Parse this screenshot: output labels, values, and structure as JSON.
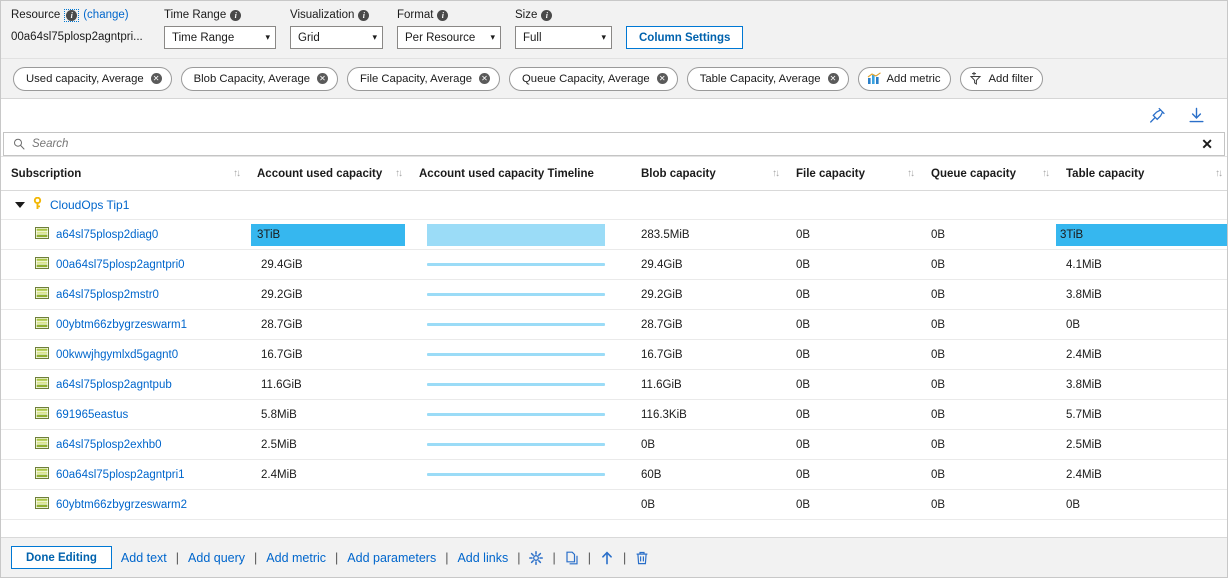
{
  "toolbar": {
    "resource": {
      "label": "Resource",
      "info_icon": "info-icon",
      "change_label": "(change)",
      "value": "00a64sl75plosp2agntpri..."
    },
    "params": [
      {
        "label": "Time Range",
        "info_icon": "info-icon",
        "value": "Time Range",
        "caret_icon": "chevron-down-icon"
      },
      {
        "label": "Visualization",
        "info_icon": "info-icon",
        "value": "Grid",
        "caret_icon": "chevron-down-icon"
      },
      {
        "label": "Format",
        "info_icon": "info-icon",
        "value": "Per Resource",
        "caret_icon": "chevron-down-icon"
      },
      {
        "label": "Size",
        "info_icon": "info-icon",
        "value": "Full",
        "caret_icon": "chevron-down-icon"
      }
    ],
    "column_settings_label": "Column Settings"
  },
  "pills": {
    "metrics": [
      {
        "label": "Used capacity, Average",
        "remove_icon": "close-circle-icon"
      },
      {
        "label": "Blob Capacity, Average",
        "remove_icon": "close-circle-icon"
      },
      {
        "label": "File Capacity, Average",
        "remove_icon": "close-circle-icon"
      },
      {
        "label": "Queue Capacity, Average",
        "remove_icon": "close-circle-icon"
      },
      {
        "label": "Table Capacity, Average",
        "remove_icon": "close-circle-icon"
      }
    ],
    "add_metric_label": "Add metric",
    "add_metric_icon": "chart-icon",
    "add_filter_label": "Add filter",
    "add_filter_icon": "filter-plus-icon"
  },
  "actions": {
    "pin_icon": "pin-icon",
    "download_icon": "download-icon"
  },
  "search": {
    "icon": "search-icon",
    "placeholder": "Search",
    "value": "",
    "clear_icon": "close-icon",
    "clear_glyph": "✕"
  },
  "table": {
    "columns": [
      {
        "label": "Subscription",
        "sortable": true
      },
      {
        "label": "Account used capacity",
        "sortable": true
      },
      {
        "label": "Account used capacity Timeline",
        "sortable": false
      },
      {
        "label": "Blob capacity",
        "sortable": true
      },
      {
        "label": "File capacity",
        "sortable": true
      },
      {
        "label": "Queue capacity",
        "sortable": true
      },
      {
        "label": "Table capacity",
        "sortable": true
      }
    ],
    "sort_glyph": "↑↓",
    "group": {
      "name": "CloudOps Tip1",
      "expanded": true,
      "icon": "key-icon",
      "toggle_icon": "triangle-down-icon"
    },
    "rows": [
      {
        "name": "a64sl75plosp2diag0",
        "icon": "storage-account-icon",
        "used_capacity": "3TiB",
        "used_bar_pct": 100,
        "used_highlight": true,
        "timeline_kind": "block",
        "timeline_pct": 100,
        "blob": "283.5MiB",
        "file": "0B",
        "queue": "0B",
        "table": "3TiB",
        "table_highlight": true
      },
      {
        "name": "00a64sl75plosp2agntpri0",
        "icon": "storage-account-icon",
        "used_capacity": "29.4GiB",
        "used_bar_pct": 0,
        "used_highlight": false,
        "timeline_kind": "line",
        "timeline_pct": 100,
        "blob": "29.4GiB",
        "file": "0B",
        "queue": "0B",
        "table": "4.1MiB",
        "table_highlight": false
      },
      {
        "name": "a64sl75plosp2mstr0",
        "icon": "storage-account-icon",
        "used_capacity": "29.2GiB",
        "used_bar_pct": 0,
        "used_highlight": false,
        "timeline_kind": "line",
        "timeline_pct": 100,
        "blob": "29.2GiB",
        "file": "0B",
        "queue": "0B",
        "table": "3.8MiB",
        "table_highlight": false
      },
      {
        "name": "00ybtm66zbygrzeswarm1",
        "icon": "storage-account-icon",
        "used_capacity": "28.7GiB",
        "used_bar_pct": 0,
        "used_highlight": false,
        "timeline_kind": "line",
        "timeline_pct": 100,
        "blob": "28.7GiB",
        "file": "0B",
        "queue": "0B",
        "table": "0B",
        "table_highlight": false
      },
      {
        "name": "00kwwjhgymlxd5gagnt0",
        "icon": "storage-account-icon",
        "used_capacity": "16.7GiB",
        "used_bar_pct": 0,
        "used_highlight": false,
        "timeline_kind": "line",
        "timeline_pct": 100,
        "blob": "16.7GiB",
        "file": "0B",
        "queue": "0B",
        "table": "2.4MiB",
        "table_highlight": false
      },
      {
        "name": "a64sl75plosp2agntpub",
        "icon": "storage-account-icon",
        "used_capacity": "11.6GiB",
        "used_bar_pct": 0,
        "used_highlight": false,
        "timeline_kind": "line",
        "timeline_pct": 100,
        "blob": "11.6GiB",
        "file": "0B",
        "queue": "0B",
        "table": "3.8MiB",
        "table_highlight": false
      },
      {
        "name": "691965eastus",
        "icon": "storage-account-icon",
        "used_capacity": "5.8MiB",
        "used_bar_pct": 0,
        "used_highlight": false,
        "timeline_kind": "line",
        "timeline_pct": 100,
        "blob": "116.3KiB",
        "file": "0B",
        "queue": "0B",
        "table": "5.7MiB",
        "table_highlight": false
      },
      {
        "name": "a64sl75plosp2exhb0",
        "icon": "storage-account-icon",
        "used_capacity": "2.5MiB",
        "used_bar_pct": 0,
        "used_highlight": false,
        "timeline_kind": "line",
        "timeline_pct": 100,
        "blob": "0B",
        "file": "0B",
        "queue": "0B",
        "table": "2.5MiB",
        "table_highlight": false
      },
      {
        "name": "60a64sl75plosp2agntpri1",
        "icon": "storage-account-icon",
        "used_capacity": "2.4MiB",
        "used_bar_pct": 0,
        "used_highlight": false,
        "timeline_kind": "line",
        "timeline_pct": 100,
        "blob": "60B",
        "file": "0B",
        "queue": "0B",
        "table": "2.4MiB",
        "table_highlight": false
      },
      {
        "name": "60ybtm66zbygrzeswarm2",
        "icon": "storage-account-icon",
        "used_capacity": "",
        "used_bar_pct": 0,
        "used_highlight": false,
        "timeline_kind": "none",
        "timeline_pct": 0,
        "blob": "0B",
        "file": "0B",
        "queue": "0B",
        "table": "0B",
        "table_highlight": false
      }
    ]
  },
  "bottom": {
    "done_label": "Done Editing",
    "links": [
      "Add text",
      "Add query",
      "Add metric",
      "Add parameters",
      "Add links"
    ],
    "separator": "|",
    "icons": [
      {
        "name": "settings-gear-icon"
      },
      {
        "name": "clone-icon"
      },
      {
        "name": "move-up-icon"
      },
      {
        "name": "delete-trash-icon"
      }
    ]
  },
  "colors": {
    "accent_blue": "#0066cc",
    "bar_blue": "#36b7ef",
    "spark_blue": "#9bdcf7",
    "toolbar_bg": "#f2f2f2"
  }
}
